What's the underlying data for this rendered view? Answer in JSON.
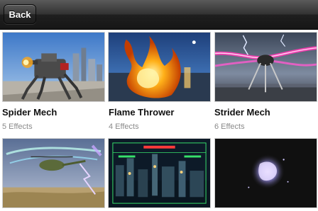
{
  "navbar": {
    "back_label": "Back"
  },
  "tiles": [
    {
      "title": "Spider Mech",
      "subtitle": "5 Effects"
    },
    {
      "title": "Flame Thrower",
      "subtitle": "4 Effects"
    },
    {
      "title": "Strider Mech",
      "subtitle": "6 Effects"
    },
    {
      "title": "",
      "subtitle": ""
    },
    {
      "title": "",
      "subtitle": ""
    },
    {
      "title": "",
      "subtitle": ""
    }
  ],
  "colors": {
    "navbar": "#2b2b2b",
    "title": "#111111",
    "subtitle": "#8a8a8a",
    "background": "#ffffff"
  }
}
